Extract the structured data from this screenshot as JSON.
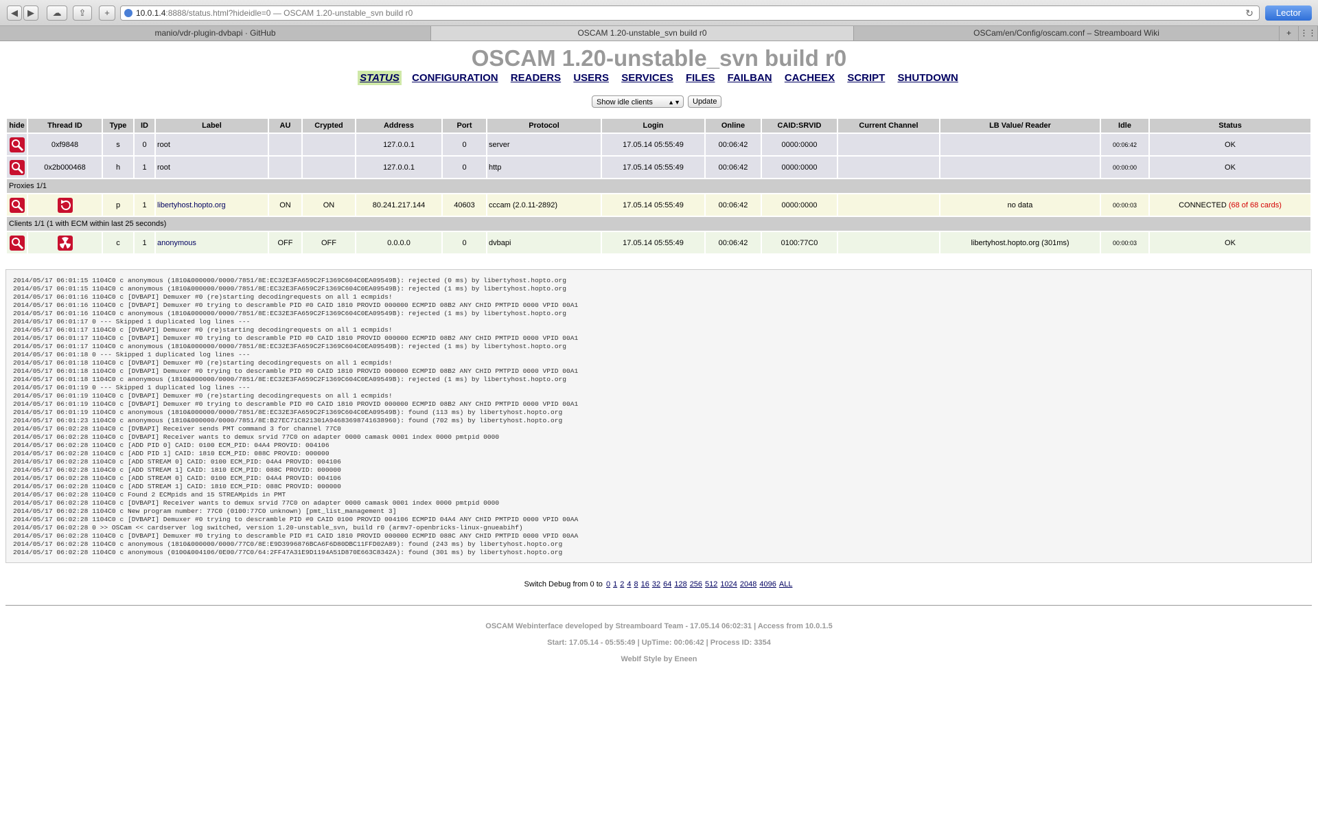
{
  "browser": {
    "url_host": "10.0.1.4",
    "url_rest": ":8888/status.html?hideidle=0 — OSCAM 1.20-unstable_svn build r0",
    "reader_label": "Lector",
    "tabs": [
      {
        "label": "manio/vdr-plugin-dvbapi · GitHub"
      },
      {
        "label": "OSCAM 1.20-unstable_svn build r0"
      },
      {
        "label": "OSCam/en/Config/oscam.conf – Streamboard Wiki"
      }
    ]
  },
  "title": "OSCAM 1.20-unstable_svn build r0",
  "nav": [
    {
      "label": "STATUS"
    },
    {
      "label": "CONFIGURATION"
    },
    {
      "label": "READERS"
    },
    {
      "label": "USERS"
    },
    {
      "label": "SERVICES"
    },
    {
      "label": "FILES"
    },
    {
      "label": "FAILBAN"
    },
    {
      "label": "CACHEEX"
    },
    {
      "label": "SCRIPT"
    },
    {
      "label": "SHUTDOWN"
    }
  ],
  "filter": {
    "select_value": "Show idle clients",
    "update_label": "Update"
  },
  "table": {
    "headers": [
      "hide",
      "Thread ID",
      "Type",
      "ID",
      "Label",
      "AU",
      "Crypted",
      "Address",
      "Port",
      "Protocol",
      "Login",
      "Online",
      "CAID:SRVID",
      "Current Channel",
      "LB Value/ Reader",
      "Idle",
      "Status"
    ],
    "servers": [
      {
        "thread": "0xf9848",
        "type": "s",
        "id": "0",
        "label": "root",
        "au": "",
        "crypted": "",
        "address": "127.0.0.1",
        "port": "0",
        "protocol": "server",
        "login": "17.05.14 05:55:49",
        "online": "00:06:42",
        "caid": "0000:0000",
        "channel": "",
        "lb": "",
        "idle": "00:06:42",
        "status": "OK"
      },
      {
        "thread": "0x2b000468",
        "type": "h",
        "id": "1",
        "label": "root",
        "au": "",
        "crypted": "",
        "address": "127.0.0.1",
        "port": "0",
        "protocol": "http",
        "login": "17.05.14 05:55:49",
        "online": "00:06:42",
        "caid": "0000:0000",
        "channel": "",
        "lb": "",
        "idle": "00:00:00",
        "status": "OK"
      }
    ],
    "proxies_header": "Proxies 1/1",
    "proxy": {
      "type": "p",
      "id": "1",
      "label": "libertyhost.hopto.org",
      "au": "ON",
      "crypted": "ON",
      "address": "80.241.217.144",
      "port": "40603",
      "protocol": "cccam (2.0.11-2892)",
      "login": "17.05.14 05:55:49",
      "online": "00:06:42",
      "caid": "0000:0000",
      "channel": "",
      "lb": "no data",
      "idle": "00:00:03",
      "status": "CONNECTED",
      "status_extra": "(68 of 68 cards)"
    },
    "clients_header": "Clients 1/1 (1 with ECM within last 25 seconds)",
    "client": {
      "type": "c",
      "id": "1",
      "label": "anonymous",
      "au": "OFF",
      "crypted": "OFF",
      "address": "0.0.0.0",
      "port": "0",
      "protocol": "dvbapi",
      "login": "17.05.14 05:55:49",
      "online": "00:06:42",
      "caid": "0100:77C0",
      "channel": "",
      "lb": "libertyhost.hopto.org (301ms)",
      "idle": "00:00:03",
      "status": "OK"
    }
  },
  "log": [
    "2014/05/17 06:01:15 1104C0 c anonymous (1810&000000/0000/7851/8E:EC32E3FA659C2F1369C604C0EA09549B): rejected (0 ms) by libertyhost.hopto.org",
    "2014/05/17 06:01:15 1104C0 c anonymous (1810&000000/0000/7851/8E:EC32E3FA659C2F1369C604C0EA09549B): rejected (1 ms) by libertyhost.hopto.org",
    "2014/05/17 06:01:16 1104C0 c [DVBAPI] Demuxer #0 (re)starting decodingrequests on all 1 ecmpids!",
    "2014/05/17 06:01:16 1104C0 c [DVBAPI] Demuxer #0 trying to descramble PID #0 CAID 1810 PROVID 000000 ECMPID 08B2 ANY CHID PMTPID 0000 VPID 00A1",
    "2014/05/17 06:01:16 1104C0 c anonymous (1810&000000/0000/7851/8E:EC32E3FA659C2F1369C604C0EA09549B): rejected (1 ms) by libertyhost.hopto.org",
    "2014/05/17 06:01:17 0 --- Skipped 1 duplicated log lines ---",
    "2014/05/17 06:01:17 1104C0 c [DVBAPI] Demuxer #0 (re)starting decodingrequests on all 1 ecmpids!",
    "2014/05/17 06:01:17 1104C0 c [DVBAPI] Demuxer #0 trying to descramble PID #0 CAID 1810 PROVID 000000 ECMPID 08B2 ANY CHID PMTPID 0000 VPID 00A1",
    "2014/05/17 06:01:17 1104C0 c anonymous (1810&000000/0000/7851/8E:EC32E3FA659C2F1369C604C0EA09549B): rejected (1 ms) by libertyhost.hopto.org",
    "2014/05/17 06:01:18 0 --- Skipped 1 duplicated log lines ---",
    "2014/05/17 06:01:18 1104C0 c [DVBAPI] Demuxer #0 (re)starting decodingrequests on all 1 ecmpids!",
    "2014/05/17 06:01:18 1104C0 c [DVBAPI] Demuxer #0 trying to descramble PID #0 CAID 1810 PROVID 000000 ECMPID 08B2 ANY CHID PMTPID 0000 VPID 00A1",
    "2014/05/17 06:01:18 1104C0 c anonymous (1810&000000/0000/7851/8E:EC32E3FA659C2F1369C604C0EA09549B): rejected (1 ms) by libertyhost.hopto.org",
    "2014/05/17 06:01:19 0 --- Skipped 1 duplicated log lines ---",
    "2014/05/17 06:01:19 1104C0 c [DVBAPI] Demuxer #0 (re)starting decodingrequests on all 1 ecmpids!",
    "2014/05/17 06:01:19 1104C0 c [DVBAPI] Demuxer #0 trying to descramble PID #0 CAID 1810 PROVID 000000 ECMPID 08B2 ANY CHID PMTPID 0000 VPID 00A1",
    "2014/05/17 06:01:19 1104C0 c anonymous (1810&000000/0000/7851/8E:EC32E3FA659C2F1369C604C0EA09549B): found (113 ms) by libertyhost.hopto.org",
    "2014/05/17 06:01:23 1104C0 c anonymous (1810&000000/0000/7851/8E:B27EC71C821301A94683698741638960): found (702 ms) by libertyhost.hopto.org",
    "2014/05/17 06:02:28 1104C0 c [DVBAPI] Receiver sends PMT command 3 for channel 77C0",
    "2014/05/17 06:02:28 1104C0 c [DVBAPI] Receiver wants to demux srvid 77C0 on adapter 0000 camask 0001 index 0000 pmtpid 0000",
    "2014/05/17 06:02:28 1104C0 c [ADD PID 0] CAID: 0100 ECM_PID: 04A4 PROVID: 004106",
    "2014/05/17 06:02:28 1104C0 c [ADD PID 1] CAID: 1810 ECM_PID: 088C PROVID: 000000",
    "2014/05/17 06:02:28 1104C0 c [ADD STREAM 0] CAID: 0100 ECM_PID: 04A4 PROVID: 004106",
    "2014/05/17 06:02:28 1104C0 c [ADD STREAM 1] CAID: 1810 ECM_PID: 088C PROVID: 000000",
    "2014/05/17 06:02:28 1104C0 c [ADD STREAM 0] CAID: 0100 ECM_PID: 04A4 PROVID: 004106",
    "2014/05/17 06:02:28 1104C0 c [ADD STREAM 1] CAID: 1810 ECM_PID: 088C PROVID: 000000",
    "2014/05/17 06:02:28 1104C0 c Found 2 ECMpids and 15 STREAMpids in PMT",
    "2014/05/17 06:02:28 1104C0 c [DVBAPI] Receiver wants to demux srvid 77C0 on adapter 0000 camask 0001 index 0000 pmtpid 0000",
    "2014/05/17 06:02:28 1104C0 c New program number: 77C0 (0100:77C0 unknown) [pmt_list_management 3]",
    "2014/05/17 06:02:28 1104C0 c [DVBAPI] Demuxer #0 trying to descramble PID #0 CAID 0100 PROVID 004106 ECMPID 04A4 ANY CHID PMTPID 0000 VPID 00AA",
    "2014/05/17 06:02:28 0 >> OSCam << cardserver log switched, version 1.20-unstable_svn, build r0 (armv7-openbricks-linux-gnueabihf)",
    "2014/05/17 06:02:28 1104C0 c [DVBAPI] Demuxer #0 trying to descramble PID #1 CAID 1810 PROVID 000000 ECMPID 088C ANY CHID PMTPID 0000 VPID 00AA",
    "2014/05/17 06:02:28 1104C0 c anonymous (1810&000000/0000/77C0/8E:E9D3996876BCA6F6D80DBC11FFD02A89): found (243 ms) by libertyhost.hopto.org",
    "2014/05/17 06:02:28 1104C0 c anonymous (0100&004106/0E00/77C0/64:2FF47A31E9D1194A51D870E663C8342A): found (301 ms) by libertyhost.hopto.org"
  ],
  "debug": {
    "prefix": "Switch Debug from 0 to",
    "levels": [
      "0",
      "1",
      "2",
      "4",
      "8",
      "16",
      "32",
      "64",
      "128",
      "256",
      "512",
      "1024",
      "2048",
      "4096",
      "ALL"
    ]
  },
  "footer": {
    "line1": "OSCAM Webinterface developed by Streamboard Team - 17.05.14 06:02:31 | Access from 10.0.1.5",
    "line2": "Start: 17.05.14 - 05:55:49 | UpTime: 00:06:42 | Process ID: 3354",
    "line3": "WebIf Style by Eneen"
  }
}
